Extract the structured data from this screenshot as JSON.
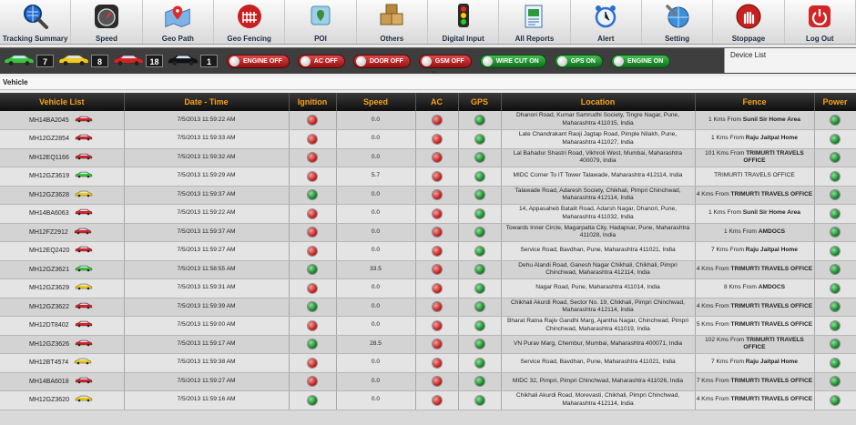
{
  "toolbar": [
    {
      "label": "Tracking Summary",
      "icon": "magnifier-globe-icon"
    },
    {
      "label": "Speed",
      "icon": "speedometer-icon"
    },
    {
      "label": "Geo Path",
      "icon": "map-pin-icon"
    },
    {
      "label": "Geo Fencing",
      "icon": "fence-icon"
    },
    {
      "label": "POI",
      "icon": "poi-pin-icon"
    },
    {
      "label": "Others",
      "icon": "boxes-icon"
    },
    {
      "label": "Digital Input",
      "icon": "traffic-light-icon"
    },
    {
      "label": "All Reports",
      "icon": "report-icon"
    },
    {
      "label": "Alert",
      "icon": "alarm-clock-icon"
    },
    {
      "label": "Setting",
      "icon": "wrench-globe-icon"
    },
    {
      "label": "Stoppage",
      "icon": "stop-hand-icon"
    },
    {
      "label": "Log Out",
      "icon": "power-icon"
    }
  ],
  "status": {
    "cars": [
      {
        "count": "7",
        "color": "#3cc33c"
      },
      {
        "count": "8",
        "color": "#f2c81a"
      },
      {
        "count": "18",
        "color": "#d62222"
      },
      {
        "count": "1",
        "color": "#111111"
      }
    ],
    "pills": [
      {
        "label": "ENGINE OFF",
        "state": "off"
      },
      {
        "label": "AC OFF",
        "state": "off"
      },
      {
        "label": "DOOR OFF",
        "state": "off"
      },
      {
        "label": "GSM OFF",
        "state": "off"
      },
      {
        "label": "WIRE CUT ON",
        "state": "on"
      },
      {
        "label": "GPS ON",
        "state": "on"
      },
      {
        "label": "ENGINE ON",
        "state": "on"
      }
    ],
    "device_list_label": "Device List"
  },
  "vehicle_bar": "Vehicle",
  "table": {
    "headers": [
      "Vehicle List",
      "Date - Time",
      "Ignition",
      "Speed",
      "AC",
      "GPS",
      "Location",
      "Fence",
      "Power"
    ],
    "rows": [
      {
        "vehicle": "MH14BA2045",
        "car": "red",
        "time": "7/5/2013 11:59:22 AM",
        "ign": "off",
        "speed": "0.0",
        "ac": "off",
        "gps": "on",
        "loc": "Dhanori Road, Kumar Samrudhi Society, Tingre Nagar, Pune, Maharashtra 411015, India",
        "fence_pre": "1 Kms From ",
        "fence_bold": "Sunil Sir Home Area",
        "power": "on"
      },
      {
        "vehicle": "MH12GZ2854",
        "car": "red",
        "time": "7/5/2013 11:59:33 AM",
        "ign": "off",
        "speed": "0.0",
        "ac": "off",
        "gps": "on",
        "loc": "Late Chandrakant Raoji Jagtap Road, Pimple Nilakh, Pune, Maharashtra 411027, India",
        "fence_pre": "1 Kms From ",
        "fence_bold": "Raju Jaitpal Home",
        "power": "on"
      },
      {
        "vehicle": "MH12EQ1166",
        "car": "red",
        "time": "7/5/2013 11:59:32 AM",
        "ign": "off",
        "speed": "0.0",
        "ac": "off",
        "gps": "on",
        "loc": "Lal Bahadur Shastri Road, Vikhroli West, Mumbai, Maharashtra 400079, India",
        "fence_pre": "101 Kms From ",
        "fence_bold": "TRIMURTI TRAVELS OFFICE",
        "power": "on"
      },
      {
        "vehicle": "MH12GZ3619",
        "car": "green",
        "time": "7/5/2013 11:59:29 AM",
        "ign": "off",
        "speed": "5.7",
        "ac": "off",
        "gps": "on",
        "loc": "MIDC Corner To IT Tower Talawade, Maharashtra 412114, India",
        "fence_pre": "TRIMURTI TRAVELS OFFICE",
        "fence_bold": "",
        "power": "on"
      },
      {
        "vehicle": "MH12GZ3628",
        "car": "yellow",
        "time": "7/5/2013 11:59:37 AM",
        "ign": "on",
        "speed": "0.0",
        "ac": "off",
        "gps": "on",
        "loc": "Talawade Road, Adaresh Society, Chikhali, Pimpri Chinchwad, Maharashtra 412114, India",
        "fence_pre": "4 Kms From ",
        "fence_bold": "TRIMURTI TRAVELS OFFICE",
        "power": "on"
      },
      {
        "vehicle": "MH14BA6063",
        "car": "red",
        "time": "7/5/2013 11:59:22 AM",
        "ign": "off",
        "speed": "0.0",
        "ac": "off",
        "gps": "on",
        "loc": "14, Appasaheb Batalit Road, Adarsh Nagar, Dhanori, Pune, Maharashtra 411032, India",
        "fence_pre": "1 Kms From ",
        "fence_bold": "Sunil Sir Home Area",
        "power": "on"
      },
      {
        "vehicle": "MH12FZ2912",
        "car": "red",
        "time": "7/5/2013 11:59:37 AM",
        "ign": "off",
        "speed": "0.0",
        "ac": "off",
        "gps": "on",
        "loc": "Towards Inner Circle, Magarpatta City, Hadapsar, Pune, Maharashtra 411028, India",
        "fence_pre": "1 Kms From ",
        "fence_bold": "AMDOCS",
        "power": "on"
      },
      {
        "vehicle": "MH12EQ2420",
        "car": "red",
        "time": "7/5/2013 11:59:27 AM",
        "ign": "off",
        "speed": "0.0",
        "ac": "off",
        "gps": "on",
        "loc": "Service Road, Bavdhan, Pune, Maharashtra 411021, India",
        "fence_pre": "7 Kms From ",
        "fence_bold": "Raju Jaitpal Home",
        "power": "on"
      },
      {
        "vehicle": "MH12GZ3621",
        "car": "green",
        "time": "7/5/2013 11:58:55 AM",
        "ign": "on",
        "speed": "33.5",
        "ac": "off",
        "gps": "on",
        "loc": "Dehu Alandi Road, Ganesh Nagar Chikhali, Chikhali, Pimpri Chinchwad, Maharashtra 412114, India",
        "fence_pre": "4 Kms From ",
        "fence_bold": "TRIMURTI TRAVELS OFFICE",
        "power": "on"
      },
      {
        "vehicle": "MH12GZ3629",
        "car": "yellow",
        "time": "7/5/2013 11:59:31 AM",
        "ign": "off",
        "speed": "0.0",
        "ac": "off",
        "gps": "on",
        "loc": "Nagar Road, Pune, Maharashtra 411014, India",
        "fence_pre": "8 Kms From ",
        "fence_bold": "AMDOCS",
        "power": "on"
      },
      {
        "vehicle": "MH12GZ3622",
        "car": "red",
        "time": "7/5/2013 11:59:39 AM",
        "ign": "on",
        "speed": "0.0",
        "ac": "off",
        "gps": "on",
        "loc": "Chikhali Akurdi Road, Sector No. 19, Chikhali, Pimpri Chinchwad, Maharashtra 412114, India",
        "fence_pre": "4 Kms From ",
        "fence_bold": "TRIMURTI TRAVELS OFFICE",
        "power": "on"
      },
      {
        "vehicle": "MH12DT8402",
        "car": "red",
        "time": "7/5/2013 11:59:00 AM",
        "ign": "off",
        "speed": "0.0",
        "ac": "off",
        "gps": "on",
        "loc": "Bharat Ratna Rajiv Gandhi Marg, Ajantha Nagar, Chinchwad, Pimpri Chinchwad, Maharashtra 411019, India",
        "fence_pre": "5 Kms From ",
        "fence_bold": "TRIMURTI TRAVELS OFFICE",
        "power": "on"
      },
      {
        "vehicle": "MH12GZ3626",
        "car": "red",
        "time": "7/5/2013 11:59:17 AM",
        "ign": "on",
        "speed": "28.5",
        "ac": "off",
        "gps": "on",
        "loc": "VN Purav Marg, Chembur, Mumbai, Maharashtra 400071, India",
        "fence_pre": "102 Kms From ",
        "fence_bold": "TRIMURTI TRAVELS OFFICE",
        "power": "on"
      },
      {
        "vehicle": "MH12BT4574",
        "car": "yellow",
        "time": "7/5/2013 11:59:38 AM",
        "ign": "off",
        "speed": "0.0",
        "ac": "off",
        "gps": "on",
        "loc": "Service Road, Bavdhan, Pune, Maharashtra 411021, India",
        "fence_pre": "7 Kms From ",
        "fence_bold": "Raju Jaitpal Home",
        "power": "on"
      },
      {
        "vehicle": "MH14BA6018",
        "car": "red",
        "time": "7/5/2013 11:59:27 AM",
        "ign": "off",
        "speed": "0.0",
        "ac": "off",
        "gps": "on",
        "loc": "MIDC 32, Pimpri, Pimpri Chinchwad, Maharashtra 411026, India",
        "fence_pre": "7 Kms From ",
        "fence_bold": "TRIMURTI TRAVELS OFFICE",
        "power": "on"
      },
      {
        "vehicle": "MH12GZ3620",
        "car": "yellow",
        "time": "7/5/2013 11:59:16 AM",
        "ign": "on",
        "speed": "0.0",
        "ac": "off",
        "gps": "on",
        "loc": "Chikhali Akurdi Road, Morevasti, Chikhali, Pimpri Chinchwad, Maharashtra 412114, India",
        "fence_pre": "4 Kms From ",
        "fence_bold": "TRIMURTI TRAVELS OFFICE",
        "power": "on"
      }
    ]
  },
  "colors": {
    "header_text": "#f7a11a",
    "on": "#17852a",
    "off": "#c81f1f",
    "car_red": "#d62222",
    "car_green": "#3cc33c",
    "car_yellow": "#f2c81a"
  }
}
